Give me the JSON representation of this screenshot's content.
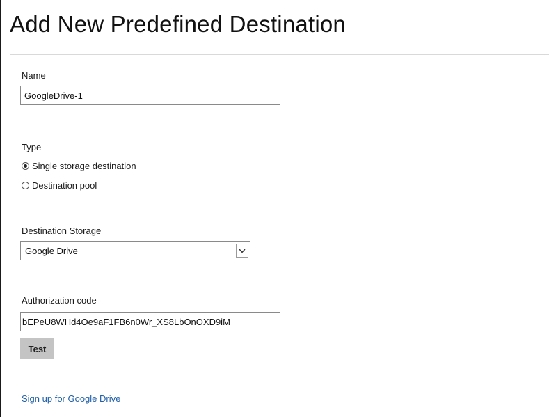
{
  "page": {
    "title": "Add New Predefined Destination"
  },
  "form": {
    "name": {
      "label": "Name",
      "value": "GoogleDrive-1"
    },
    "type": {
      "label": "Type",
      "options": [
        {
          "label": "Single storage destination",
          "selected": true
        },
        {
          "label": "Destination pool",
          "selected": false
        }
      ]
    },
    "destination_storage": {
      "label": "Destination Storage",
      "selected": "Google Drive"
    },
    "authorization_code": {
      "label": "Authorization code",
      "value": "bEPeU8WHd4Oe9aF1FB6n0Wr_XS8LbOnOXD9iM"
    },
    "test_button_label": "Test",
    "signup_link_label": "Sign up for Google Drive"
  },
  "icons": {
    "select_arrow": "chevron-down-icon",
    "radio_selected": "radio-checked-icon",
    "radio_unselected": "radio-unchecked-icon"
  },
  "colors": {
    "link": "#1f5fa8",
    "button_bg": "#c4c4c4",
    "input_border": "#8a8a8a"
  }
}
